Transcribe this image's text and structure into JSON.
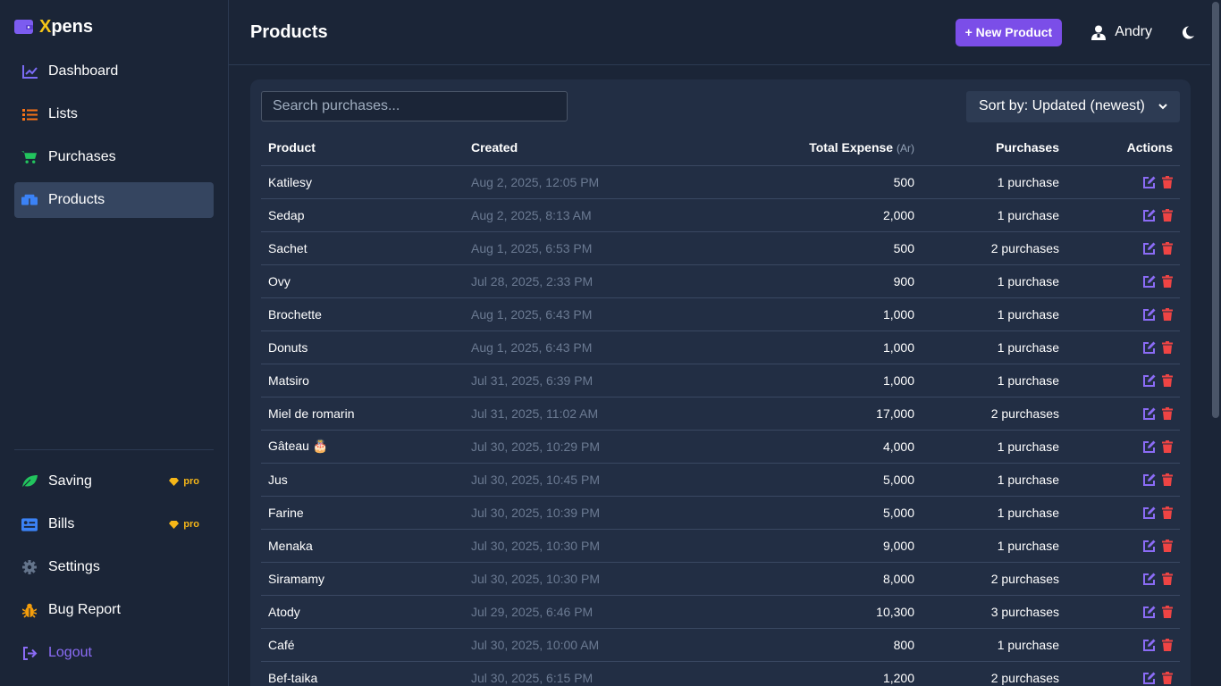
{
  "app": {
    "brand_first": "X",
    "brand_rest": "pens"
  },
  "sidebar": {
    "items": [
      {
        "label": "Dashboard",
        "icon": "chart-line-icon",
        "color": "#7c6cf6"
      },
      {
        "label": "Lists",
        "icon": "list-icon",
        "color": "#f97316"
      },
      {
        "label": "Purchases",
        "icon": "cart-icon",
        "color": "#22c55e"
      },
      {
        "label": "Products",
        "icon": "boxes-icon",
        "color": "#3b82f6",
        "active": true
      }
    ],
    "bottom": [
      {
        "label": "Saving",
        "icon": "leaf-icon",
        "color": "#22c55e",
        "badge": "pro"
      },
      {
        "label": "Bills",
        "icon": "bill-icon",
        "color": "#3b82f6",
        "badge": "pro"
      },
      {
        "label": "Settings",
        "icon": "gear-icon",
        "color": "#64748b"
      },
      {
        "label": "Bug Report",
        "icon": "bug-icon",
        "color": "#f59e0b"
      },
      {
        "label": "Logout",
        "icon": "logout-icon",
        "color": "#8b6cf6"
      }
    ]
  },
  "header": {
    "title": "Products",
    "new_button": "+ New Product",
    "user": "Andry"
  },
  "toolbar": {
    "search_placeholder": "Search purchases...",
    "sort_value": "Sort by: Updated (newest)"
  },
  "table": {
    "headers": {
      "product": "Product",
      "created": "Created",
      "total": "Total Expense",
      "unit": "(Ar)",
      "purchases": "Purchases",
      "actions": "Actions"
    },
    "rows": [
      {
        "product": "Katilesy",
        "created": "Aug 2, 2025, 12:05 PM",
        "total": "500",
        "purchases": "1 purchase"
      },
      {
        "product": "Sedap",
        "created": "Aug 2, 2025, 8:13 AM",
        "total": "2,000",
        "purchases": "1 purchase"
      },
      {
        "product": "Sachet",
        "created": "Aug 1, 2025, 6:53 PM",
        "total": "500",
        "purchases": "2 purchases"
      },
      {
        "product": "Ovy",
        "created": "Jul 28, 2025, 2:33 PM",
        "total": "900",
        "purchases": "1 purchase"
      },
      {
        "product": "Brochette",
        "created": "Aug 1, 2025, 6:43 PM",
        "total": "1,000",
        "purchases": "1 purchase"
      },
      {
        "product": "Donuts",
        "created": "Aug 1, 2025, 6:43 PM",
        "total": "1,000",
        "purchases": "1 purchase"
      },
      {
        "product": "Matsiro",
        "created": "Jul 31, 2025, 6:39 PM",
        "total": "1,000",
        "purchases": "1 purchase"
      },
      {
        "product": "Miel de romarin",
        "created": "Jul 31, 2025, 11:02 AM",
        "total": "17,000",
        "purchases": "2 purchases"
      },
      {
        "product": "Gâteau 🎂",
        "created": "Jul 30, 2025, 10:29 PM",
        "total": "4,000",
        "purchases": "1 purchase"
      },
      {
        "product": "Jus",
        "created": "Jul 30, 2025, 10:45 PM",
        "total": "5,000",
        "purchases": "1 purchase"
      },
      {
        "product": "Farine",
        "created": "Jul 30, 2025, 10:39 PM",
        "total": "5,000",
        "purchases": "1 purchase"
      },
      {
        "product": "Menaka",
        "created": "Jul 30, 2025, 10:30 PM",
        "total": "9,000",
        "purchases": "1 purchase"
      },
      {
        "product": "Siramamy",
        "created": "Jul 30, 2025, 10:30 PM",
        "total": "8,000",
        "purchases": "2 purchases"
      },
      {
        "product": "Atody",
        "created": "Jul 29, 2025, 6:46 PM",
        "total": "10,300",
        "purchases": "3 purchases"
      },
      {
        "product": "Café",
        "created": "Jul 30, 2025, 10:00 AM",
        "total": "800",
        "purchases": "1 purchase"
      },
      {
        "product": "Bef-taika",
        "created": "Jul 30, 2025, 6:15 PM",
        "total": "1,200",
        "purchases": "2 purchases"
      }
    ]
  },
  "colors": {
    "accent": "#7b4ee8",
    "edit": "#8b6cf6",
    "delete": "#ef4444",
    "pro": "#f5b618"
  }
}
